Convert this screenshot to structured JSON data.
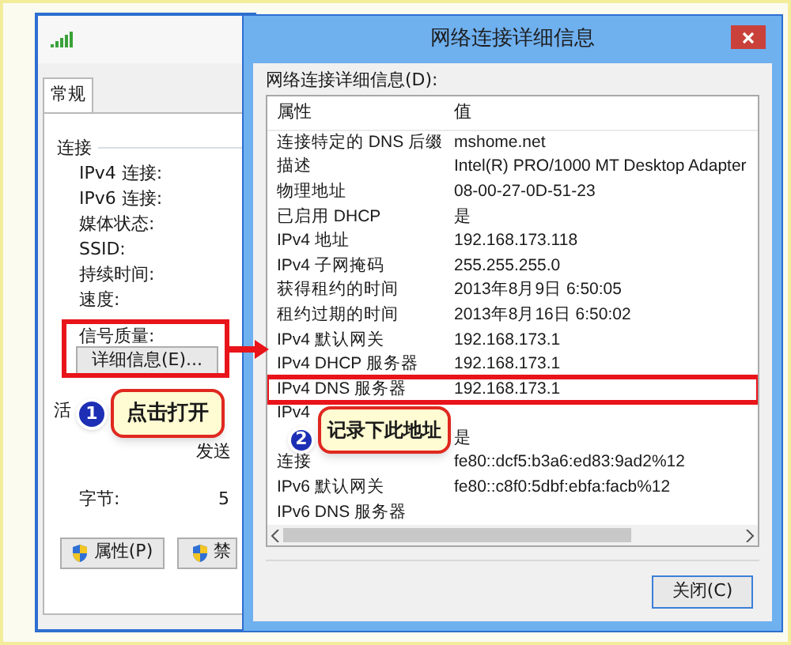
{
  "back_window": {
    "tab": {
      "label": "常规",
      "selected": true
    },
    "group_title": "连接",
    "fields": [
      "IPv4 连接:",
      "IPv6 连接:",
      "媒体状态:",
      "SSID:",
      "持续时间:",
      "速度:"
    ],
    "signal_label": "信号质量:",
    "details_button": "详细信息(E)...",
    "activity_title": "活",
    "sent_label": "发送",
    "bytes_label": "字节:",
    "bytes_value": "5",
    "buttons": [
      "属性(P)",
      "禁"
    ]
  },
  "dialog": {
    "title": "网络连接详细信息",
    "list_label": "网络连接详细信息(D):",
    "columns": [
      "属性",
      "值"
    ],
    "rows": [
      {
        "property": "连接特定的 DNS 后缀",
        "value": "mshome.net",
        "marked": false
      },
      {
        "property": "描述",
        "value": "Intel(R) PRO/1000 MT Desktop Adapter",
        "marked": false
      },
      {
        "property": "物理地址",
        "value": "08-00-27-0D-51-23",
        "marked": false
      },
      {
        "property": "已启用 DHCP",
        "value": "是",
        "marked": false
      },
      {
        "property": "IPv4 地址",
        "value": "192.168.173.118",
        "marked": false
      },
      {
        "property": "IPv4 子网掩码",
        "value": "255.255.255.0",
        "marked": false
      },
      {
        "property": "获得租约的时间",
        "value": "2013年8月9日 6:50:05",
        "marked": false
      },
      {
        "property": "租约过期的时间",
        "value": "2013年8月16日 6:50:02",
        "marked": false
      },
      {
        "property": "IPv4 默认网关",
        "value": "192.168.173.1",
        "marked": false
      },
      {
        "property": "IPv4 DHCP 服务器",
        "value": "192.168.173.1",
        "marked": false
      },
      {
        "property": "IPv4 DNS 服务器",
        "value": "192.168.173.1",
        "marked": true
      },
      {
        "property": "IPv4",
        "marked": false
      },
      {
        "value": "是",
        "marked": false
      },
      {
        "property": "连接",
        "value": "fe80::dcf5:b3a6:ed83:9ad2%12",
        "marked": false
      },
      {
        "property": "IPv6 默认网关",
        "value": "fe80::c8f0:5dbf:ebfa:facb%12",
        "marked": false
      },
      {
        "property": "IPv6 DNS 服务器",
        "marked": false
      }
    ],
    "close_button": "关闭(C)"
  },
  "annotations": [
    {
      "number": "1",
      "text": "点击打开"
    },
    {
      "number": "2",
      "text": "记录下此地址"
    }
  ]
}
